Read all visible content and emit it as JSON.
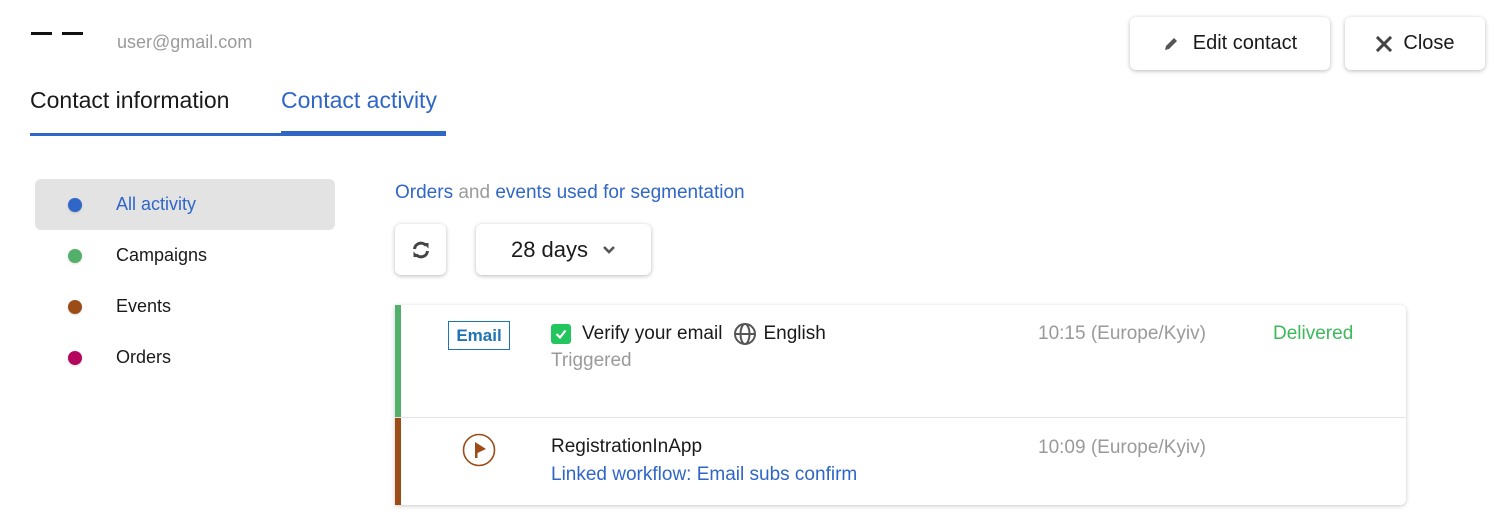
{
  "header": {
    "contact_name_placeholder": "– –",
    "email": "user@gmail.com",
    "edit_button": {
      "label": "Edit contact",
      "icon": "pencil-icon"
    },
    "close_button": {
      "label": "Close",
      "icon": "close-icon"
    }
  },
  "tabs": [
    {
      "label": "Contact information",
      "active": false
    },
    {
      "label": "Contact activity",
      "active": true
    }
  ],
  "sidebar": {
    "items": [
      {
        "label": "All activity",
        "color": "#2f66c8",
        "active": true
      },
      {
        "label": "Campaigns",
        "color": "#52b06a",
        "active": false
      },
      {
        "label": "Events",
        "color": "#9c4d17",
        "active": false
      },
      {
        "label": "Orders",
        "color": "#b5065e",
        "active": false
      }
    ]
  },
  "segmentation": {
    "link1": "Orders",
    "connector": "and",
    "link2": "events used for segmentation"
  },
  "toolbar": {
    "refresh_icon": "refresh-icon",
    "period": {
      "selected": "28 days",
      "icon": "chevron-down-icon"
    }
  },
  "activities": [
    {
      "type": "campaign",
      "bar_color": "#52b06a",
      "badge": "Email",
      "checked": true,
      "title": "Verify your email",
      "language_icon": "globe-icon",
      "language": "English",
      "subtitle": "Triggered",
      "time": "10:15 (Europe/Kyiv)",
      "status": "Delivered",
      "status_color": "#3cb95a"
    },
    {
      "type": "event",
      "bar_color": "#9c4d17",
      "icon": "flag-icon",
      "title": "RegistrationInApp",
      "subtitle": "Linked workflow: Email subs confirm",
      "time": "10:09 (Europe/Kyiv)",
      "status": ""
    }
  ]
}
